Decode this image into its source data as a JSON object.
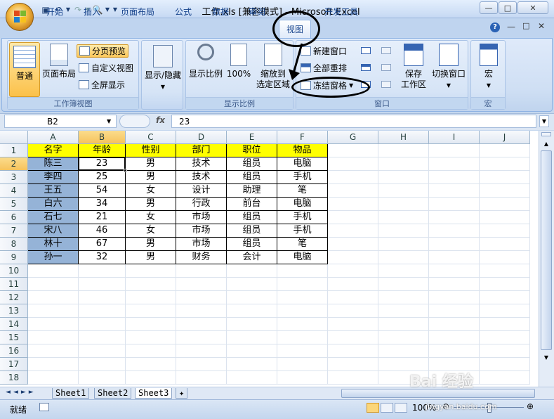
{
  "window": {
    "title": "工作.xls  [兼容模式] - Microsoft Excel"
  },
  "tabs": [
    "开始",
    "插入",
    "页面布局",
    "公式",
    "数据",
    "审阅",
    "视图",
    "开发工具"
  ],
  "ribbon": {
    "workbook_views": {
      "label": "工作簿视图",
      "normal": "普通",
      "page_layout": "页面布局",
      "page_break": "分页预览",
      "custom_views": "自定义视图",
      "full_screen": "全屏显示"
    },
    "show_hide": {
      "label": "显示/隐藏"
    },
    "zoom": {
      "label": "显示比例",
      "zoom_btn": "显示比例",
      "zoom100": "100%",
      "zoom_selection_l1": "缩放到",
      "zoom_selection_l2": "选定区域"
    },
    "window": {
      "label": "窗口",
      "new_window": "新建窗口",
      "arrange_all": "全部重排",
      "freeze_panes": "冻结窗格",
      "save_workspace_l1": "保存",
      "save_workspace_l2": "工作区",
      "switch_windows": "切换窗口"
    },
    "macros": {
      "label": "宏",
      "btn": "宏"
    }
  },
  "formula_bar": {
    "name_box": "B2",
    "fx": "fx",
    "value": "23"
  },
  "columns": [
    "A",
    "B",
    "C",
    "D",
    "E",
    "F",
    "G",
    "H",
    "I",
    "J"
  ],
  "rows": [
    "1",
    "2",
    "3",
    "4",
    "5",
    "6",
    "7",
    "8",
    "9",
    "10",
    "11",
    "12",
    "13",
    "14",
    "15",
    "16",
    "17",
    "18"
  ],
  "table": {
    "headers": [
      "名字",
      "年龄",
      "性别",
      "部门",
      "职位",
      "物品"
    ],
    "rows": [
      [
        "陈三",
        "23",
        "男",
        "技术",
        "组员",
        "电脑"
      ],
      [
        "李四",
        "25",
        "男",
        "技术",
        "组员",
        "手机"
      ],
      [
        "王五",
        "54",
        "女",
        "设计",
        "助理",
        "笔"
      ],
      [
        "白六",
        "34",
        "男",
        "行政",
        "前台",
        "电脑"
      ],
      [
        "石七",
        "21",
        "女",
        "市场",
        "组员",
        "手机"
      ],
      [
        "宋八",
        "46",
        "女",
        "市场",
        "组员",
        "手机"
      ],
      [
        "林十",
        "67",
        "男",
        "市场",
        "组员",
        "笔"
      ],
      [
        "孙一",
        "32",
        "男",
        "财务",
        "会计",
        "电脑"
      ]
    ]
  },
  "sheets": [
    "Sheet1",
    "Sheet2",
    "Sheet3"
  ],
  "status": {
    "ready": "就绪",
    "zoom": "100%"
  },
  "watermark": {
    "brand": "Bai 经验",
    "url": "jingyan.baidu.com"
  }
}
